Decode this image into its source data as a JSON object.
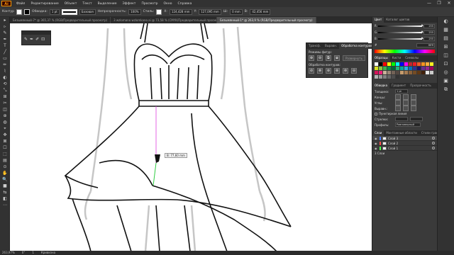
{
  "app": {
    "logo": "Ai",
    "menu": [
      "Файл",
      "Редактирование",
      "Объект",
      "Текст",
      "Выделение",
      "Эффект",
      "Просмотр",
      "Окно",
      "Справка"
    ],
    "window_controls": [
      "—",
      "❐",
      "✕"
    ]
  },
  "control_bar": {
    "selection_label": "Контур",
    "stroke_label": "Обводка:",
    "stroke_value": "1 pt",
    "profile_value": "Базовая",
    "opacity_label": "Непрозрачность:",
    "opacity_value": "100%",
    "style_label": "Стиль:",
    "x_label": "X:",
    "x_value": "124,428 mm",
    "y_label": "Y:",
    "y_value": "127,095 mm",
    "w_label": "Ш:",
    "w_value": "0 mm",
    "h_label": "В:",
    "h_value": "42,456 mm"
  },
  "tabs": [
    {
      "label": "Безымянный-7* @ 365,37 % (RGB/Предварительный просмотр)",
      "active": false
    },
    {
      "label": "3 wzlomano wzlomkano.ai @ 73,58 % (CMYK/Предварительный просмотр)",
      "active": false
    },
    {
      "label": "Безымянный-1* @ 263,9 % (RGB/Предварительный просмотр)",
      "active": true
    }
  ],
  "tools": [
    "▸",
    "▹",
    "✎",
    "✒",
    "T",
    "╱",
    "▭",
    "✏",
    "⌇",
    "◐",
    "⟲",
    "⤡",
    "⊞",
    "✂",
    "◫",
    "⊕",
    "◍",
    "⌖",
    "✥",
    "⊠",
    "☐",
    "⬚",
    "▤",
    "⊙",
    "✋",
    "🔍",
    "■",
    "⇆",
    "◧",
    "⋯"
  ],
  "brush_panel": {
    "icons": [
      "✎",
      "✒",
      "✐",
      "⊡"
    ]
  },
  "pathfinder": {
    "tabs": [
      "Трансф.",
      "Выравн.",
      "Обработка контуров"
    ],
    "active_tab": 2,
    "shape_modes_label": "Режимы фигур:",
    "shape_mode_buttons": [
      "⊕",
      "⊖",
      "⧉",
      "⧈"
    ],
    "expand_label": "Развернуть",
    "pathfinders_label": "Обработка контуров:",
    "pathfinder_buttons": [
      "⊘",
      "⊗",
      "⊚",
      "⊛",
      "⊜",
      "⊝"
    ]
  },
  "tooltip": {
    "text": "В: 77,60 mm"
  },
  "color_panel": {
    "tabs": [
      "Цвет",
      "Каталог цветов"
    ],
    "rows": [
      {
        "label": "R",
        "value": "255",
        "level": 1.0
      },
      {
        "label": "G",
        "value": "255",
        "level": 1.0
      },
      {
        "label": "B",
        "value": "255",
        "level": 1.0
      }
    ],
    "hex_label": "#",
    "hex_value": "ffffff"
  },
  "swatches_panel": {
    "tabs": [
      "Образцы",
      "Кисти",
      "Символы"
    ],
    "colors": [
      "#ffffff",
      "#000000",
      "#ff0000",
      "#ffff00",
      "#00ff00",
      "#00ffff",
      "#0000ff",
      "#ff00ff",
      "#c1272d",
      "#ed1c24",
      "#f15a24",
      "#f7931e",
      "#fbb03b",
      "#fcee21",
      "#d9e021",
      "#8cc63f",
      "#39b54a",
      "#009245",
      "#006837",
      "#22b573",
      "#00a99d",
      "#29abe2",
      "#0071bc",
      "#2e3192",
      "#1b1464",
      "#662d91",
      "#93278f",
      "#9e005d",
      "#d4145a",
      "#ed1e79",
      "#c7b299",
      "#998675",
      "#736357",
      "#534741",
      "#c69c6d",
      "#a67c52",
      "#8c6239",
      "#754c24",
      "#603813",
      "#42210b",
      "#e6e6e6",
      "#cccccc",
      "#b3b3b3",
      "#999999",
      "#808080",
      "#666666",
      "#4d4d4d",
      "#333333"
    ]
  },
  "stroke_panel": {
    "tabs": [
      "Обводка",
      "Градиент",
      "Прозрачность"
    ],
    "rows": [
      {
        "label": "Толщина:",
        "value": "1 pt"
      },
      {
        "label": "Концы:",
        "value": ""
      },
      {
        "label": "Углы:",
        "value": ""
      },
      {
        "label": "Выравн.:",
        "value": ""
      }
    ],
    "dashed_label": "Пунктирная линия",
    "arrows_label": "Стрелки:",
    "profile_label": "Профиль:",
    "profile_value": "Равномерный"
  },
  "layers_panel": {
    "tabs": [
      "Слои",
      "Монтажные области",
      "Стили графики"
    ],
    "layers": [
      {
        "name": "Слой 3",
        "color": "#4f7fff",
        "selected": true
      },
      {
        "name": "Слой 2",
        "color": "#ff4f4f",
        "selected": false
      },
      {
        "name": "Слой 1",
        "color": "#4fff4f",
        "selected": false
      }
    ],
    "count_label": "3 Слои"
  },
  "statusbar": {
    "zoom": "263,97%",
    "rotation": "0°",
    "artboard": "1",
    "tool_name": "Кривизна"
  },
  "right_strip": {
    "icons": [
      "◐",
      "▦",
      "▤",
      "⊞",
      "◫",
      "⊡",
      "◎",
      "▣",
      "⧉"
    ]
  }
}
